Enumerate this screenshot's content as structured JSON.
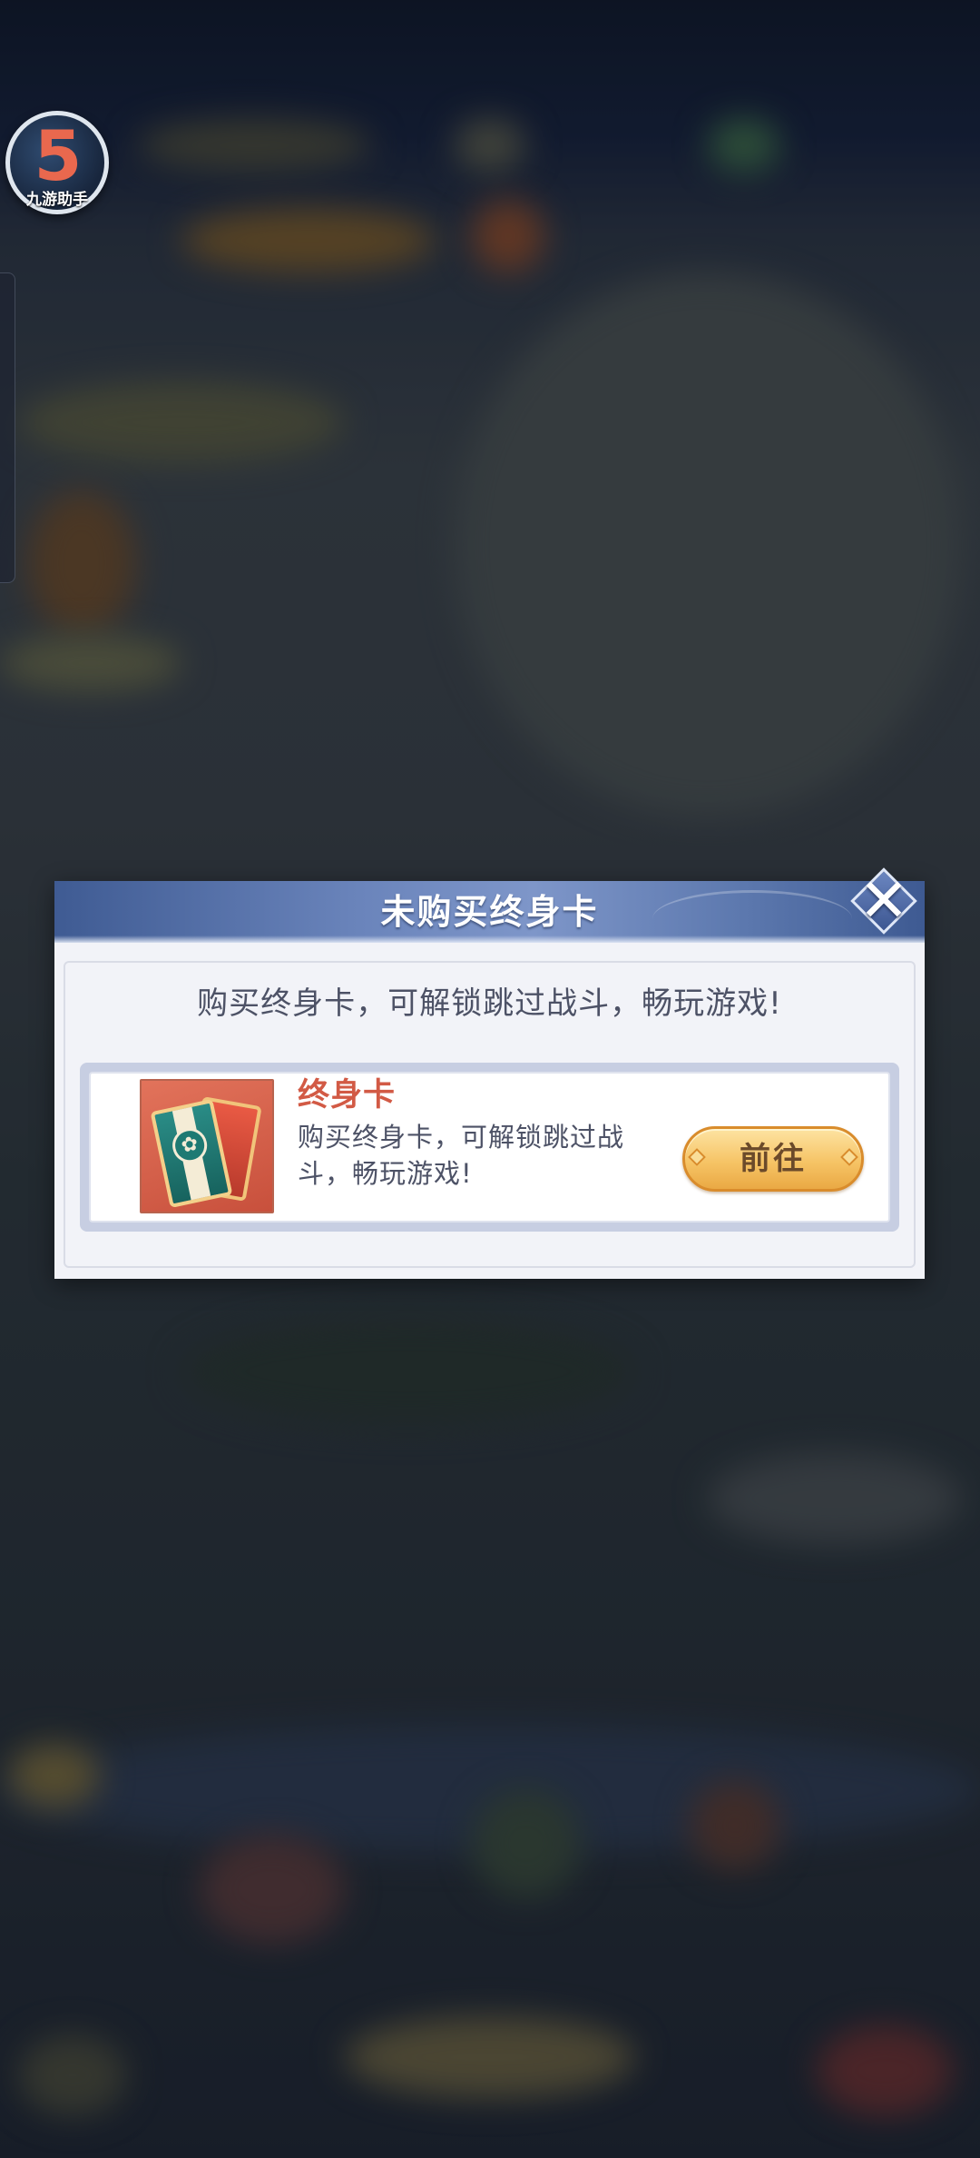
{
  "assistant": {
    "glyph": "5",
    "label": "九游助手",
    "icon": "assistant-logo-icon"
  },
  "dialog": {
    "title": "未购买终身卡",
    "close_icon": "close-icon",
    "message": "购买终身卡，可解锁跳过战斗，畅玩游戏!",
    "product": {
      "name": "终身卡",
      "description": "购买终身卡，可解锁跳过战斗，畅玩游戏!",
      "icon": "lifetime-card-icon",
      "button_label": "前往"
    }
  },
  "colors": {
    "header": "#5b77ad",
    "product_name": "#d25a45",
    "button": "#f6c466",
    "text": "#4d5266"
  }
}
